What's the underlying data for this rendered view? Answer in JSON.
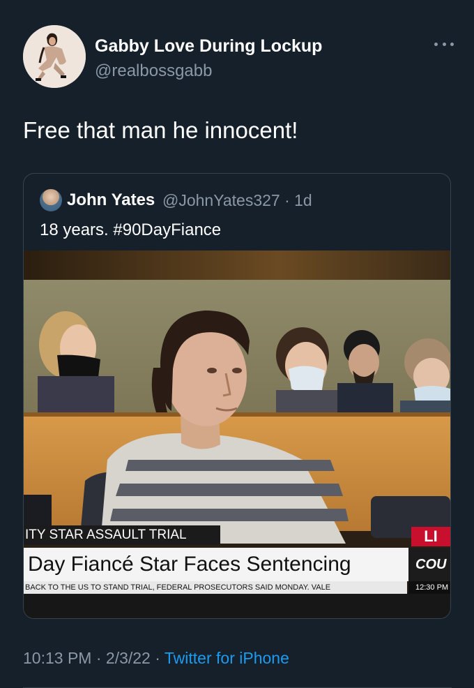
{
  "author": {
    "name": "Gabby Love During Lockup",
    "handle": "@realbossgabb"
  },
  "more_icon": "more-horizontal-icon",
  "tweet": {
    "text": "Free that man he innocent!"
  },
  "quoted_tweet": {
    "name": "John Yates",
    "handle_time": "@JohnYates327 · 1d",
    "text": "18 years. #90DayFiance",
    "media": {
      "banner_top": "ITY STAR ASSAULT TRIAL",
      "banner_main": "Day Fiancé Star Faces Sentencing",
      "ticker": "BACK TO THE US TO STAND TRIAL, FEDERAL PROSECUTORS SAID MONDAY. VALE",
      "live_label": "LI",
      "network_label": "COU",
      "clock": "12:30 PM"
    }
  },
  "footer": {
    "time": "10:13 PM",
    "sep1": " · ",
    "date": "2/3/22",
    "sep2": " · ",
    "source": "Twitter for iPhone"
  },
  "colors": {
    "background": "#15202b",
    "secondary_text": "#8b98a5",
    "link": "#1d9bf0",
    "border": "#38444d"
  }
}
